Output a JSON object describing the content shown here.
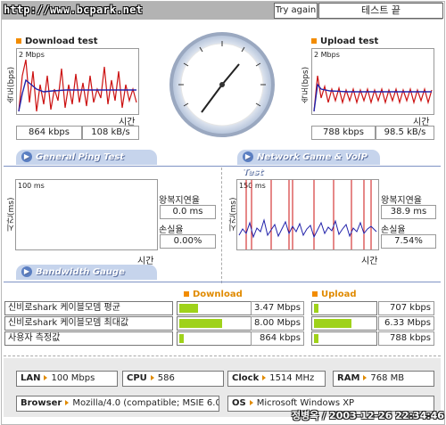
{
  "header": {
    "url": "http://www.bcpark.net",
    "try_again": "Try again",
    "test_done": "테스트 끝"
  },
  "download": {
    "title": "Download test",
    "yaxis": "속도(bps)",
    "scale": "2 Mbps",
    "xaxis": "시간",
    "kbps": "864 kbps",
    "kBs": "108 kB/s"
  },
  "upload": {
    "title": "Upload test",
    "yaxis": "속도(bps)",
    "scale": "2 Mbps",
    "xaxis": "시간",
    "kbps": "788 kbps",
    "kBs": "98.5 kB/s"
  },
  "tabs": {
    "ping": "General Ping Test",
    "game": "Network Game & VoIP Test",
    "bandwidth": "Bandwidth Gauge"
  },
  "ping": {
    "yaxis": "시간(ms)",
    "scale": "100 ms",
    "xaxis": "시간",
    "rtt_label": "왕복지연율",
    "rtt_value": "0.0 ms",
    "loss_label": "손실율",
    "loss_value": "0.00%"
  },
  "game": {
    "yaxis": "시간(ms)",
    "scale": "150 ms",
    "xaxis": "시간",
    "rtt_label": "왕복지연율",
    "rtt_value": "38.9 ms",
    "loss_label": "손실율",
    "loss_value": "7.54%"
  },
  "bandwidth": {
    "download_header": "Download",
    "upload_header": "Upload",
    "rows": [
      {
        "label": "신비로shark 케이블모뎀 평균",
        "down": "3.47 Mbps",
        "down_frac": 0.27,
        "up": "707 kbps",
        "up_frac": 0.07
      },
      {
        "label": "신비로shark 케이블모뎀 최대값",
        "down": "8.00 Mbps",
        "down_frac": 0.62,
        "up": "6.33 Mbps",
        "up_frac": 0.62
      },
      {
        "label": "사용자 측정값",
        "down": "864 kbps",
        "down_frac": 0.07,
        "up": "788 kbps",
        "up_frac": 0.08
      }
    ]
  },
  "system": {
    "lan_label": "LAN",
    "lan": "100 Mbps",
    "cpu_label": "CPU",
    "cpu": "586",
    "clock_label": "Clock",
    "clock": "1514 MHz",
    "ram_label": "RAM",
    "ram": "768 MB",
    "browser_label": "Browser",
    "browser": "Mozilla/4.0 (compatible; MSIE 6.0",
    "os_label": "OS",
    "os": "Microsoft Windows XP"
  },
  "footer": {
    "stamp": "정병옥 / 2003-12-26 22:34:46"
  },
  "colors": {
    "accent": "#f28c00",
    "tab": "#c6d4ec",
    "bar": "#9fd21a",
    "graph_red": "#cc1111",
    "graph_blue": "#2222aa"
  }
}
